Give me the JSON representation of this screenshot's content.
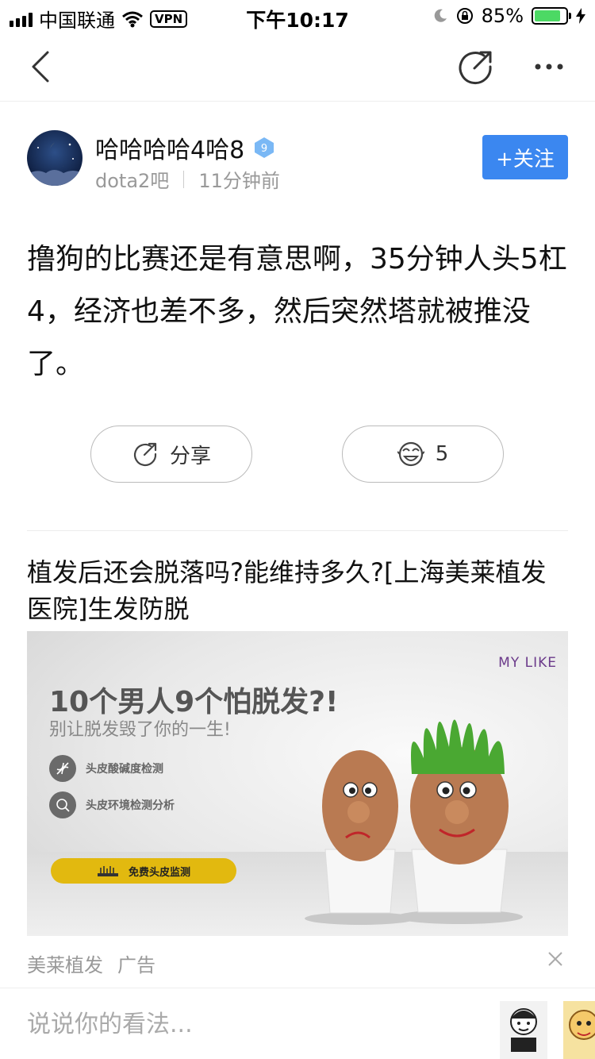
{
  "status_bar": {
    "carrier": "中国联通",
    "vpn": "VPN",
    "time": "下午10:17",
    "battery_percent": "85%",
    "battery_level": 0.85
  },
  "nav": {
    "back_icon": "chevron-left-icon",
    "share_icon": "share-icon",
    "more_icon": "more-icon"
  },
  "author": {
    "name": "哈哈哈哈4哈8",
    "vip_level": "9",
    "forum": "dota2吧",
    "time_ago": "11分钟前",
    "follow_label": "+关注"
  },
  "post": {
    "content": "撸狗的比赛还是有意思啊，35分钟人头5杠4，经济也差不多，然后突然塔就被推没了。"
  },
  "actions": {
    "share_label": "分享",
    "like_count": "5"
  },
  "ad": {
    "title": "植发后还会脱落吗?能维持多久?[上海美莱植发医院]生发防脱",
    "brand": "MY LIKE",
    "headline": "10个男人9个怕脱发?!",
    "subheadline": "别让脱发毁了你的一生!",
    "features": [
      "头皮酸碱度检测",
      "头皮环境检测分析"
    ],
    "cta": "免费头皮监测",
    "sponsor": "美莱植发",
    "ad_label": "广告"
  },
  "comment": {
    "placeholder": "说说你的看法..."
  },
  "colors": {
    "accent": "#3b87f0",
    "cta_yellow": "#e2b90f",
    "battery_green": "#4cd964"
  }
}
